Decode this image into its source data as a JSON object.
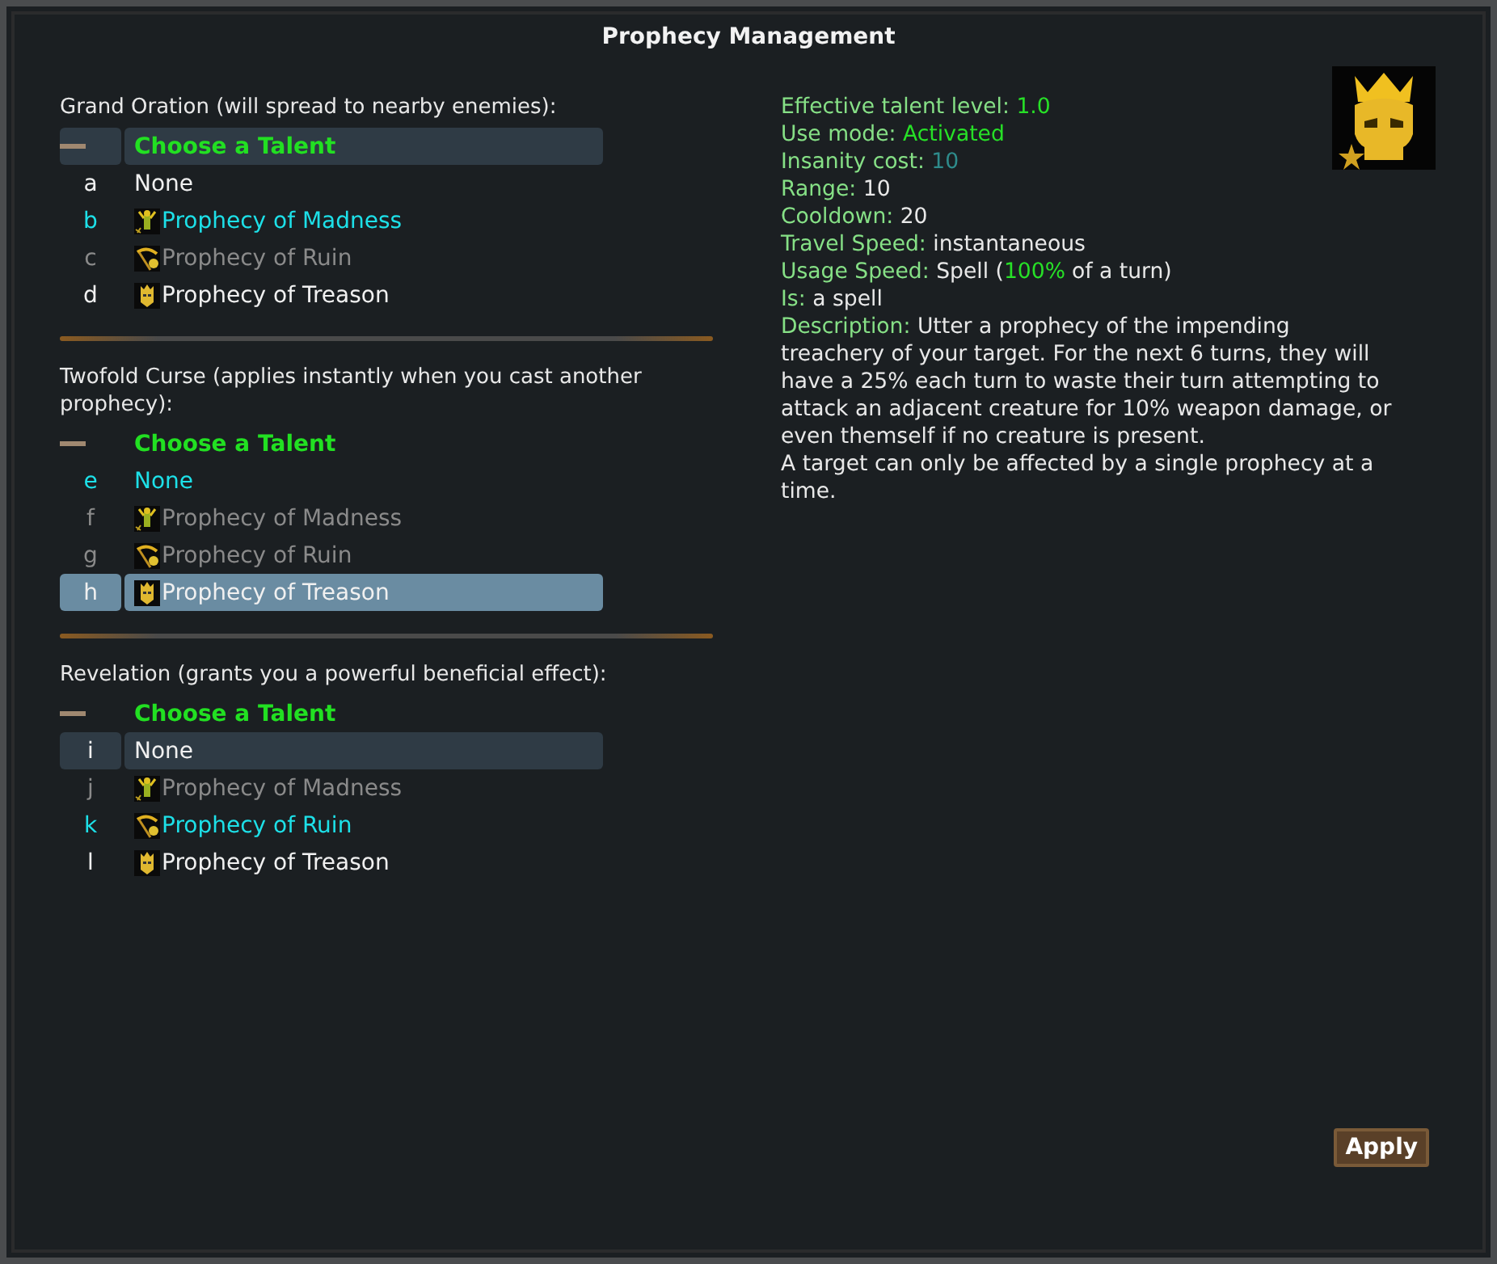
{
  "window": {
    "title": "Prophecy Management"
  },
  "sections": [
    {
      "title": "Grand Oration (will spread to nearby enemies):",
      "header": {
        "label": "Choose a Talent",
        "focused": true
      },
      "options": [
        {
          "key": "a",
          "label": "None",
          "kind": "plain",
          "chosen": false,
          "disabled": false,
          "selected": false,
          "focused": false
        },
        {
          "key": "b",
          "label": "Prophecy of Madness",
          "kind": "madness",
          "chosen": true,
          "disabled": false,
          "selected": false,
          "focused": false
        },
        {
          "key": "c",
          "label": "Prophecy of Ruin",
          "kind": "ruin",
          "chosen": false,
          "disabled": true,
          "selected": false,
          "focused": false
        },
        {
          "key": "d",
          "label": "Prophecy of Treason",
          "kind": "treason",
          "chosen": false,
          "disabled": false,
          "selected": false,
          "focused": false
        }
      ]
    },
    {
      "title": "Twofold Curse (applies instantly when you cast another prophecy):",
      "header": {
        "label": "Choose a Talent",
        "focused": false
      },
      "options": [
        {
          "key": "e",
          "label": "None",
          "kind": "plain",
          "chosen": true,
          "disabled": false,
          "selected": false,
          "focused": false
        },
        {
          "key": "f",
          "label": "Prophecy of Madness",
          "kind": "madness",
          "chosen": false,
          "disabled": true,
          "selected": false,
          "focused": false
        },
        {
          "key": "g",
          "label": "Prophecy of Ruin",
          "kind": "ruin",
          "chosen": false,
          "disabled": true,
          "selected": false,
          "focused": false
        },
        {
          "key": "h",
          "label": "Prophecy of Treason",
          "kind": "treason",
          "chosen": false,
          "disabled": false,
          "selected": true,
          "focused": false
        }
      ]
    },
    {
      "title": "Revelation (grants you a powerful beneficial effect):",
      "header": {
        "label": "Choose a Talent",
        "focused": false
      },
      "options": [
        {
          "key": "i",
          "label": "None",
          "kind": "plain",
          "chosen": false,
          "disabled": false,
          "selected": false,
          "focused": true
        },
        {
          "key": "j",
          "label": "Prophecy of Madness",
          "kind": "madness",
          "chosen": false,
          "disabled": true,
          "selected": false,
          "focused": false
        },
        {
          "key": "k",
          "label": "Prophecy of Ruin",
          "kind": "ruin",
          "chosen": true,
          "disabled": false,
          "selected": false,
          "focused": false
        },
        {
          "key": "l",
          "label": "Prophecy of Treason",
          "kind": "treason",
          "chosen": false,
          "disabled": false,
          "selected": false,
          "focused": false
        }
      ]
    }
  ],
  "details": {
    "lines": [
      {
        "label": "Effective talent level:",
        "parts": [
          {
            "text": "1.0",
            "color": "#27e027"
          }
        ]
      },
      {
        "label": "Use mode:",
        "parts": [
          {
            "text": "Activated",
            "color": "#27e027"
          }
        ]
      },
      {
        "label": "Insanity cost:",
        "parts": [
          {
            "text": "10",
            "color": "#2e8b8b"
          }
        ]
      },
      {
        "label": "Range:",
        "parts": [
          {
            "text": "10",
            "color": "#e8e8e8"
          }
        ]
      },
      {
        "label": "Cooldown:",
        "parts": [
          {
            "text": "20",
            "color": "#e8e8e8"
          }
        ]
      },
      {
        "label": "Travel Speed:",
        "parts": [
          {
            "text": "instantaneous",
            "color": "#e8e8e8"
          }
        ]
      },
      {
        "label": "Usage Speed:",
        "parts": [
          {
            "text": "Spell (",
            "color": "#e8e8e8"
          },
          {
            "text": "100%",
            "color": "#27e027"
          },
          {
            "text": "of a turn)",
            "color": "#e8e8e8",
            "gap_before": true
          }
        ]
      },
      {
        "label": "Is:",
        "parts": [
          {
            "text": "a spell",
            "color": "#e8e8e8"
          }
        ]
      },
      {
        "label": "Description:",
        "parts": [
          {
            "text": "Utter a prophecy of the impending treachery of your target. For the next 6 turns, they will have a 25% each turn to waste their turn attempting to attack an adjacent creature for 10% weapon damage, or even themself if no creature is present.",
            "color": "#e8e8e8"
          }
        ]
      }
    ],
    "note": "A target can only be affected by a single prophecy at a time."
  },
  "buttons": [
    {
      "label": "Apply"
    }
  ]
}
